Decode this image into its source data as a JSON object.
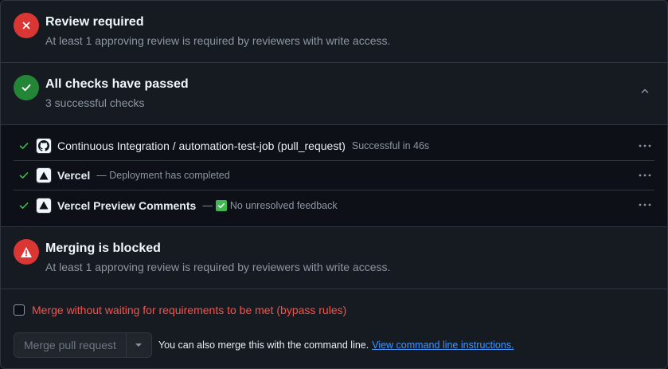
{
  "review": {
    "title": "Review required",
    "subtitle": "At least 1 approving review is required by reviewers with write access.",
    "icon": "x-circle-icon",
    "color": "#da3633"
  },
  "checks": {
    "title": "All checks have passed",
    "subtitle": "3 successful checks",
    "icon": "check-circle-icon",
    "color": "#238636",
    "items": [
      {
        "name": "Continuous Integration / automation-test-job (pull_request)",
        "description": "Successful in 46s",
        "app_icon": "github-icon",
        "more": "···"
      },
      {
        "name": "Vercel",
        "description": "— Deployment has completed",
        "app_icon": "vercel-icon",
        "more": "···"
      },
      {
        "name": "Vercel Preview Comments",
        "description_prefix": "—",
        "description": "No unresolved feedback",
        "app_icon": "vercel-icon",
        "more": "···"
      }
    ]
  },
  "blocked": {
    "title": "Merging is blocked",
    "subtitle": "At least 1 approving review is required by reviewers with write access.",
    "icon": "alert-icon",
    "color": "#da3633"
  },
  "merge": {
    "bypass_label": "Merge without waiting for requirements to be met (bypass rules)",
    "button_label": "Merge pull request",
    "help_text": "You can also merge this with the command line.",
    "link_text": "View command line instructions."
  }
}
